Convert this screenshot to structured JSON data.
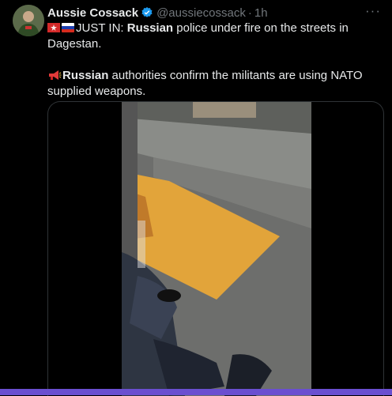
{
  "author": {
    "name": "Aussie Cossack",
    "handle": "@aussiecossack",
    "time_sep": "·",
    "time": "1h"
  },
  "more_label": "···",
  "tweet": {
    "line1_prefix": "JUST IN: ",
    "line1_bold": "Russian",
    "line1_rest": " police under fire on the streets in Dagestan.",
    "line2_bold": "Russian",
    "line2_rest": " authorities confirm the militants are using NATO supplied weapons."
  },
  "icons": {
    "verified": "verified-badge-icon",
    "flag1": "dagestan-flag-icon",
    "flag2": "russia-flag-icon",
    "megaphone": "megaphone-icon",
    "more": "more-options-icon"
  },
  "colors": {
    "background": "#000000",
    "text": "#e7e9ea",
    "muted": "#71767b",
    "verified": "#1d9bf0",
    "accent_bar": "#6a4fd0"
  }
}
